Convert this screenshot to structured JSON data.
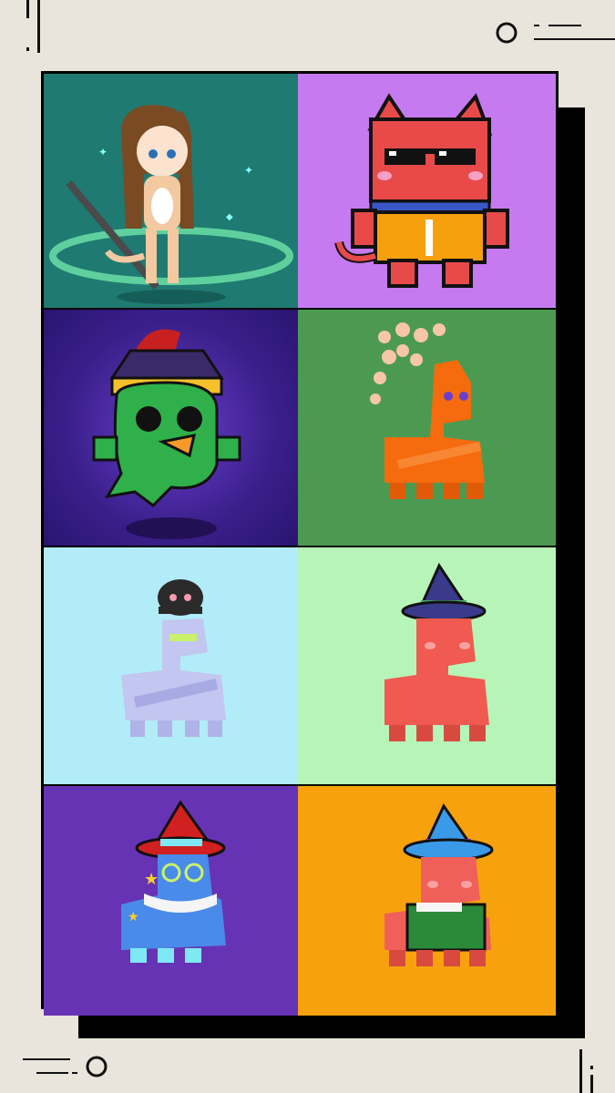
{
  "tiles": [
    {
      "subject": "anime-cat-girl-with-staff",
      "bg": "#1f7a72"
    },
    {
      "subject": "red-cat-with-sunglasses",
      "bg": "#c57af0"
    },
    {
      "subject": "green-ghost-bird-with-hat",
      "bg": "#4a2a9c"
    },
    {
      "subject": "orange-alpaca-with-bubbles",
      "bg": "#4c9a52"
    },
    {
      "subject": "lavender-alpaca-with-octopus-hat",
      "bg": "#b2ecf8"
    },
    {
      "subject": "pink-alpaca-witch-hat",
      "bg": "#b7f4b8"
    },
    {
      "subject": "blue-alpaca-red-witch-hat",
      "bg": "#6633b5"
    },
    {
      "subject": "pink-alpaca-blue-witch-hat",
      "bg": "#f7a20d"
    }
  ],
  "colors": {
    "page_bg": "#e9e5dc",
    "frame": "#000000"
  }
}
